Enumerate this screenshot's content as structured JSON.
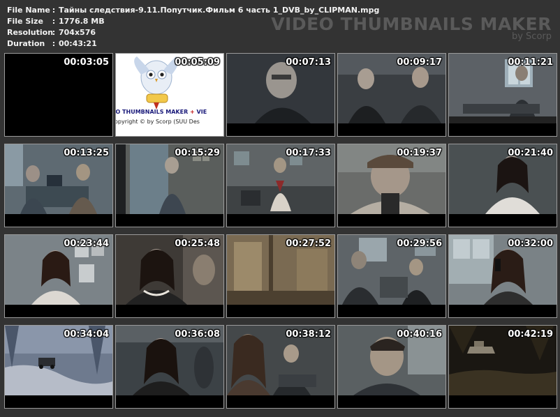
{
  "info": {
    "rows": [
      {
        "key": "File Name",
        "value": "Тайны следствия-9.11.Попутчик.Фильм 6 часть 1_DVB_by_CLIPMAN.mpg"
      },
      {
        "key": "File Size",
        "value": "1776.8 MB"
      },
      {
        "key": "Resolution",
        "value": "704x576"
      },
      {
        "key": "Duration",
        "value": "00:43:21"
      }
    ]
  },
  "brand": {
    "title": "VIDEO THUMBNAILS MAKER",
    "subtitle": "by Scorp"
  },
  "logo": {
    "line1": "EO THUMBNAILS MAKER",
    "plus": "+",
    "line1b": "VIE",
    "line2": "opyright © by Scorp (SUU Des"
  },
  "thumbnails": [
    {
      "time": "00:03:05",
      "scene": "black"
    },
    {
      "time": "00:05:09",
      "scene": "logo"
    },
    {
      "time": "00:07:13",
      "scene": "dark-portrait"
    },
    {
      "time": "00:09:17",
      "scene": "two-men"
    },
    {
      "time": "00:11:21",
      "scene": "office-window"
    },
    {
      "time": "00:13:25",
      "scene": "office-desk"
    },
    {
      "time": "00:15:29",
      "scene": "doorway"
    },
    {
      "time": "00:17:33",
      "scene": "office-man"
    },
    {
      "time": "00:19:37",
      "scene": "old-man-cap"
    },
    {
      "time": "00:21:40",
      "scene": "woman-dark"
    },
    {
      "time": "00:23:44",
      "scene": "woman-wall"
    },
    {
      "time": "00:25:48",
      "scene": "woman-pearls"
    },
    {
      "time": "00:27:52",
      "scene": "sepia-room"
    },
    {
      "time": "00:29:56",
      "scene": "meeting"
    },
    {
      "time": "00:32:00",
      "scene": "woman-phone"
    },
    {
      "time": "00:34:04",
      "scene": "forest-car"
    },
    {
      "time": "00:36:08",
      "scene": "woman-dark2"
    },
    {
      "time": "00:38:12",
      "scene": "couple"
    },
    {
      "time": "00:40:16",
      "scene": "man-closeup"
    },
    {
      "time": "00:42:19",
      "scene": "night-boat"
    }
  ]
}
